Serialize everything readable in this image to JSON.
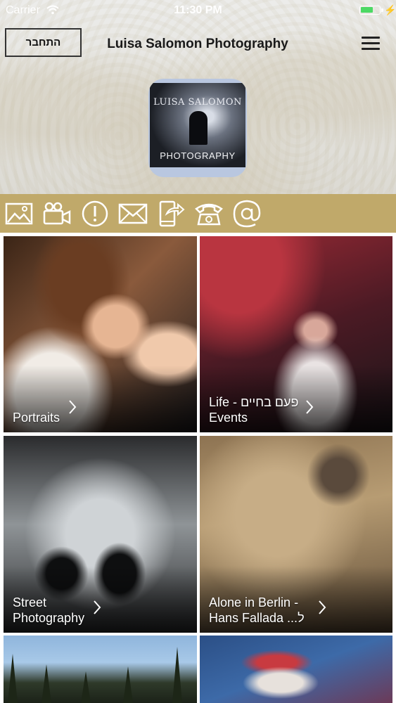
{
  "status_bar": {
    "carrier": "Carrier",
    "time": "11:30 PM",
    "battery_level_percent": 70
  },
  "header": {
    "login_label": "התחבר",
    "title": "Luisa Salomon Photography",
    "logo": {
      "top_text": "LUISA SALOMON",
      "bottom_text": "PHOTOGRAPHY"
    }
  },
  "colors": {
    "action_bar": "#c0a96a",
    "action_icon": "#ffffff",
    "battery_fill": "#4cd964"
  },
  "action_icons": [
    "gallery-icon",
    "video-camera-icon",
    "info-alert-icon",
    "mail-icon",
    "share-phone-icon",
    "telephone-icon",
    "at-sign-icon"
  ],
  "tiles": [
    {
      "line1": "Portraits",
      "line2": ""
    },
    {
      "line1": "Life - פעם בחיים",
      "line2": "Events"
    },
    {
      "line1": "Street",
      "line2": "Photography"
    },
    {
      "line1": "Alone in Berlin -",
      "line2": "Hans Fallada ...ל"
    },
    {
      "line1": "",
      "line2": ""
    },
    {
      "line1": "",
      "line2": ""
    }
  ]
}
